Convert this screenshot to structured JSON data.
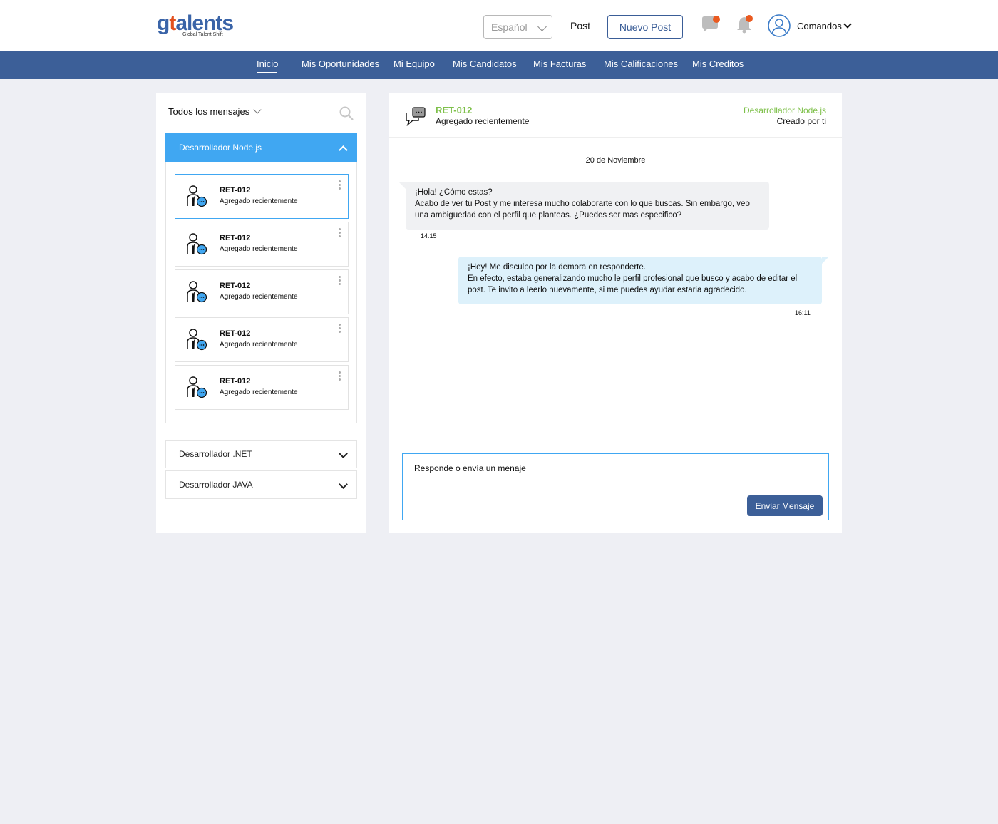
{
  "header": {
    "logo_text_1": "g",
    "logo_text_2": "t",
    "logo_text_3": "alents",
    "logo_tagline": "Global Talent Shift",
    "language": "Español",
    "post_link": "Post",
    "new_post_button": "Nuevo Post",
    "user_name": "Comandos",
    "brand_color": "#3c5f98",
    "notification_dot_color": "#ea5a20"
  },
  "nav": {
    "items": [
      {
        "label": "Inicio",
        "active": true
      },
      {
        "label": "Mis Oportunidades"
      },
      {
        "label": "Mi Equipo"
      },
      {
        "label": "Mis Candidatos"
      },
      {
        "label": "Mis Facturas"
      },
      {
        "label": "Mis Calificaciones"
      },
      {
        "label": "Mis Creditos"
      }
    ]
  },
  "sidebar": {
    "filter_label": "Todos los mensajes",
    "groups": [
      {
        "title": "Desarrollador Node.js",
        "expanded": true,
        "candidates": [
          {
            "code": "RET-012",
            "status": "Agregado recientemente",
            "selected": true
          },
          {
            "code": "RET-012",
            "status": "Agregado recientemente"
          },
          {
            "code": "RET-012",
            "status": "Agregado recientemente"
          },
          {
            "code": "RET-012",
            "status": "Agregado recientemente"
          },
          {
            "code": "RET-012",
            "status": "Agregado recientemente"
          }
        ]
      },
      {
        "title": "Desarrollador .NET",
        "expanded": false
      },
      {
        "title": "Desarrollador JAVA",
        "expanded": false
      }
    ],
    "accent_color": "#40a7f2"
  },
  "conversation": {
    "candidate_code": "RET-012",
    "candidate_status": "Agregado recientemente",
    "job_title": "Desarrollador Node.js",
    "created_by": "Creado por ti",
    "date": "20 de Noviembre",
    "messages": [
      {
        "direction": "in",
        "lines": [
          "¡Hola! ¿Cómo estas?",
          "Acabo de ver tu Post y me interesa mucho colaborarte con lo que buscas. Sin embargo, veo",
          "una ambiguedad con el perfil que planteas. ¿Puedes ser mas especifico?"
        ],
        "time": "14:15"
      },
      {
        "direction": "out",
        "lines": [
          "¡Hey! Me disculpo por la demora en responderte.",
          "En efecto, estaba generalizando mucho le perfil profesional que busco y acabo de editar el",
          "post. Te invito a leerlo nuevamente, si me puedes ayudar estaria agradecido."
        ],
        "time": "16:11"
      }
    ],
    "composer_placeholder": "Responde o envía un menaje",
    "send_button": "Enviar Mensaje"
  }
}
